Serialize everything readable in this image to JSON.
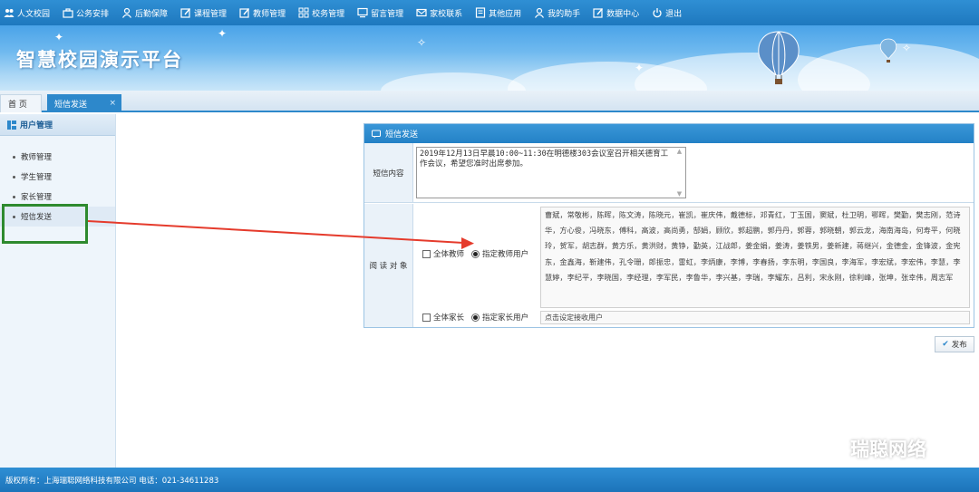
{
  "nav": {
    "items": [
      {
        "label": "人文校园",
        "icon": "people-icon"
      },
      {
        "label": "公务安排",
        "icon": "briefcase-icon"
      },
      {
        "label": "后勤保障",
        "icon": "user-icon"
      },
      {
        "label": "课程管理",
        "icon": "edit-icon"
      },
      {
        "label": "教师管理",
        "icon": "edit-icon"
      },
      {
        "label": "校务管理",
        "icon": "grid-icon"
      },
      {
        "label": "留言管理",
        "icon": "monitor-icon"
      },
      {
        "label": "家校联系",
        "icon": "mail-icon"
      },
      {
        "label": "其他应用",
        "icon": "document-icon"
      },
      {
        "label": "我的助手",
        "icon": "user-icon"
      },
      {
        "label": "数据中心",
        "icon": "edit-icon"
      },
      {
        "label": "退出",
        "icon": "power-icon"
      }
    ]
  },
  "banner": {
    "title": "智慧校园演示平台"
  },
  "tabs": {
    "home": "首 页",
    "active": "短信发送",
    "close": "×"
  },
  "sidebar": {
    "title": "用户管理",
    "items": [
      "教师管理",
      "学生管理",
      "家长管理",
      "短信发送"
    ],
    "selected": "短信发送"
  },
  "panel": {
    "title": "短信发送",
    "content_label": "短信内容",
    "content_text": "2019年12月13日早晨10:00~11:30在明德楼303会议室召开相关德育工作会议，希望您准时出席参加。",
    "audience_label": "阅 读 对 象",
    "teacher_options": {
      "all": "全体教师",
      "specified": "指定教师用户"
    },
    "parent_options": {
      "all": "全体家长",
      "specified": "指定家长用户"
    },
    "teacher_list": "曹斌，常敬彬，陈晖，陈文涛，陈晓元，崔凯，崔庆伟，戴德标，邓青红，丁玉国，窦斌，杜卫明，鄂晖，樊勤，樊志刚，范诗华，方心俊，冯晓东，傅科，高波，高尚勇，郜娟，顾欣，郭超鹏，郭丹丹，郭蓉，郭晓朝，郭云龙，海南海岛，何寿平，何晓玲，贺军，胡志群，黄方乐，黄洪财，黄铮，勤英，江战郎，姜金娟，姜涛，姜铁男，姜新建，蒋继兴，金德金，金锋波，金宪东，金鑫海，靳建伟，孔令珊，郎振忠，雷虹，李炳康，李博，李春扬，李东明，李国良，李海军，李宏斌，李宏伟，李慧，李慧婷，李纪平，李晓国，李经理，李军民，李鲁华，李兴基，李瑞，李耀东，吕利，宋永刚，徐利峰，张坤，张幸伟，周志军",
    "parent_list": "点击设定接收用户",
    "send_button": "发布"
  },
  "watermark": "瑞聪网络",
  "footer": {
    "copyright": "版权所有：上海瑞聪网络科技有限公司 电话：021-34611283"
  },
  "colors": {
    "primary": "#2d88cb",
    "highlight_box": "#2e8a2e",
    "arrow": "#e53b2c"
  }
}
